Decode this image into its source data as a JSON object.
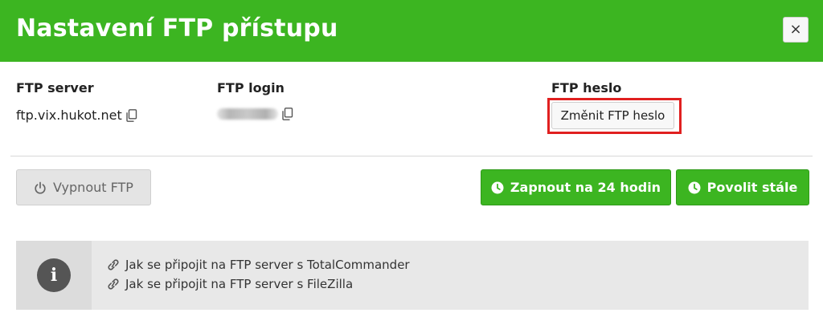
{
  "header": {
    "title": "Nastavení FTP přístupu",
    "close_label": "×",
    "bg_color": "#3cb521"
  },
  "credentials": {
    "server": {
      "label": "FTP server",
      "value": "ftp.vix.hukot.net",
      "icon": "copy-icon"
    },
    "login": {
      "label": "FTP login",
      "value_obscured": true,
      "icon": "copy-icon"
    },
    "password": {
      "label": "FTP heslo",
      "change_button": "Změnit FTP heslo",
      "highlight_color": "#e02020"
    }
  },
  "actions": {
    "disable_ftp": {
      "label": "Vypnout FTP",
      "icon": "power-icon"
    },
    "enable_24h": {
      "label": "Zapnout na 24 hodin",
      "icon": "clock-icon"
    },
    "enable_always": {
      "label": "Povolit stále",
      "icon": "clock-icon"
    }
  },
  "info": {
    "icon": "info-icon",
    "links": [
      {
        "label": "Jak se připojit na FTP server s TotalCommander",
        "icon": "link-icon"
      },
      {
        "label": "Jak se připojit na FTP server s FileZilla",
        "icon": "link-icon"
      }
    ]
  }
}
